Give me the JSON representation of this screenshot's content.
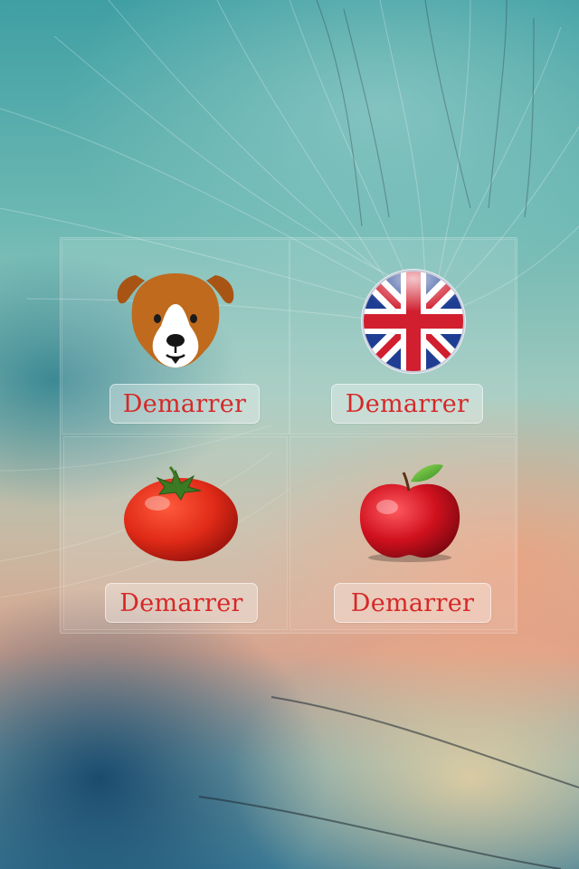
{
  "tiles": [
    {
      "icon": "dog-face-icon",
      "button_label": "Demarrer"
    },
    {
      "icon": "uk-flag-icon",
      "button_label": "Demarrer"
    },
    {
      "icon": "tomato-icon",
      "button_label": "Demarrer"
    },
    {
      "icon": "apple-icon",
      "button_label": "Demarrer"
    }
  ],
  "colors": {
    "button_text": "#d62828",
    "background_teal": "#3f9fa3",
    "background_peach": "#d9a58f"
  }
}
